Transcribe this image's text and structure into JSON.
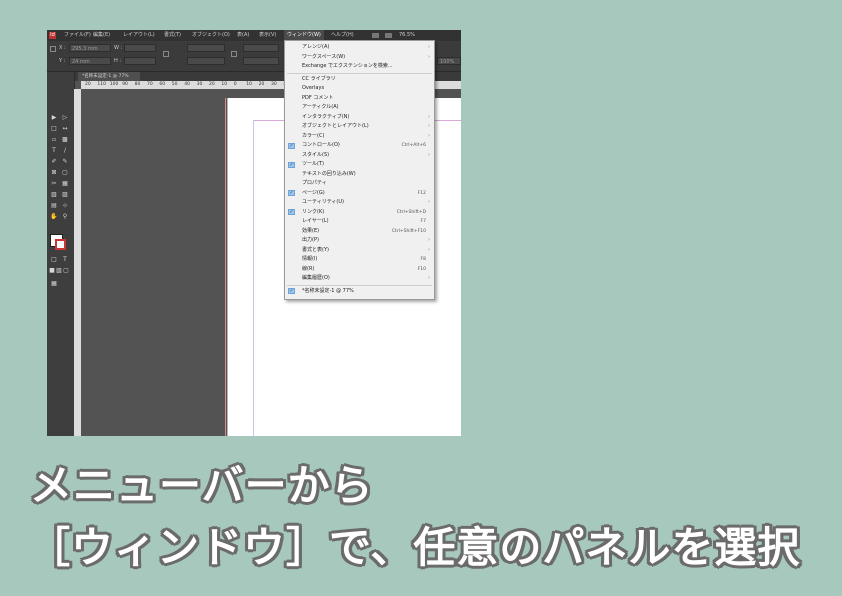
{
  "menubar": {
    "logo": "Id",
    "items": [
      "ファイル(F)",
      "編集(E)",
      "レイアウト(L)",
      "書式(T)",
      "オブジェクト(O)",
      "表(A)",
      "表示(V)",
      "ウィンドウ(W)",
      "ヘルプ(H)"
    ],
    "zoom": "76.5%"
  },
  "control": {
    "x_label": "X :",
    "x_value": "295.3 mm",
    "y_label": "Y :",
    "y_value": "24 mm",
    "w_label": "W :",
    "h_label": "H :",
    "right_value": "100%"
  },
  "document_tab": "*名称未設定-1 @ 77%",
  "ruler": [
    "20",
    "110",
    "100",
    "90",
    "80",
    "70",
    "60",
    "50",
    "40",
    "30",
    "20",
    "10",
    "0",
    "10",
    "20",
    "30",
    "40"
  ],
  "window_menu": {
    "items": [
      {
        "label": "アレンジ(A)",
        "shortcut": "",
        "submenu": true,
        "checked": false
      },
      {
        "label": "ワークスペース(W)",
        "shortcut": "",
        "submenu": true,
        "checked": false
      },
      {
        "label": "Exchange でエクステンションを検索...",
        "shortcut": "",
        "submenu": false,
        "checked": false
      },
      {
        "sep": true
      },
      {
        "label": "CC ライブラリ",
        "shortcut": "",
        "submenu": false,
        "checked": false
      },
      {
        "label": "Overlays",
        "shortcut": "",
        "submenu": false,
        "checked": false
      },
      {
        "label": "PDF コメント",
        "shortcut": "",
        "submenu": false,
        "checked": false
      },
      {
        "label": "アーティクル(A)",
        "shortcut": "",
        "submenu": false,
        "checked": false
      },
      {
        "label": "インタラクティブ(N)",
        "shortcut": "",
        "submenu": true,
        "checked": false
      },
      {
        "label": "オブジェクトとレイアウト(L)",
        "shortcut": "",
        "submenu": true,
        "checked": false
      },
      {
        "label": "カラー(C)",
        "shortcut": "",
        "submenu": true,
        "checked": false
      },
      {
        "label": "コントロール(O)",
        "shortcut": "Ctrl+Alt+6",
        "submenu": false,
        "checked": true
      },
      {
        "label": "スタイル(S)",
        "shortcut": "",
        "submenu": true,
        "checked": false
      },
      {
        "label": "ツール(T)",
        "shortcut": "",
        "submenu": false,
        "checked": true
      },
      {
        "label": "テキストの回り込み(W)",
        "shortcut": "",
        "submenu": false,
        "checked": false
      },
      {
        "label": "プロパティ",
        "shortcut": "",
        "submenu": false,
        "checked": false
      },
      {
        "label": "ページ(G)",
        "shortcut": "F12",
        "submenu": false,
        "checked": true
      },
      {
        "label": "ユーティリティ(U)",
        "shortcut": "",
        "submenu": true,
        "checked": false
      },
      {
        "label": "リンク(K)",
        "shortcut": "Ctrl+Shift+D",
        "submenu": false,
        "checked": true
      },
      {
        "label": "レイヤー(L)",
        "shortcut": "F7",
        "submenu": false,
        "checked": false
      },
      {
        "label": "効果(E)",
        "shortcut": "Ctrl+Shift+F10",
        "submenu": false,
        "checked": false
      },
      {
        "label": "出力(P)",
        "shortcut": "",
        "submenu": true,
        "checked": false
      },
      {
        "label": "書式と表(Y)",
        "shortcut": "",
        "submenu": true,
        "checked": false
      },
      {
        "label": "情報(I)",
        "shortcut": "F8",
        "submenu": false,
        "checked": false
      },
      {
        "label": "線(R)",
        "shortcut": "F10",
        "submenu": false,
        "checked": false
      },
      {
        "label": "編集履歴(O)",
        "shortcut": "",
        "submenu": true,
        "checked": false
      },
      {
        "sep": true
      },
      {
        "label": "*名称未設定-1 @ 77%",
        "shortcut": "",
        "submenu": false,
        "checked": true
      }
    ]
  },
  "caption": {
    "line1": "メニューバーから",
    "line2": "［ウィンドウ］で、任意のパネルを選択"
  }
}
